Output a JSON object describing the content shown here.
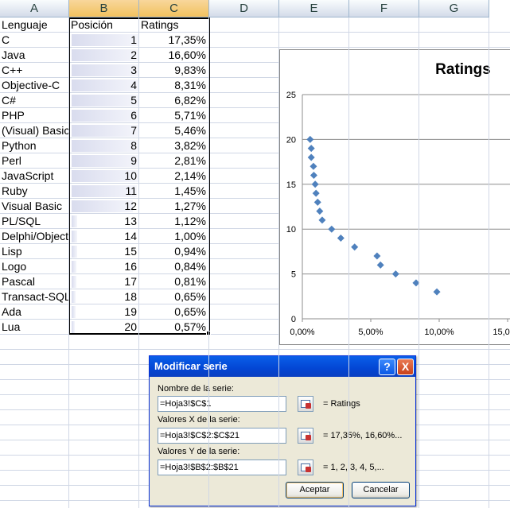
{
  "columns": [
    "A",
    "B",
    "C",
    "D",
    "E",
    "F",
    "G"
  ],
  "header_row": {
    "a": "Lenguaje",
    "b": "Posición",
    "c": "Ratings"
  },
  "rows": [
    {
      "lang": "C",
      "pos": "1",
      "rating": "17,35%",
      "bar": 1.0
    },
    {
      "lang": "Java",
      "pos": "2",
      "rating": "16,60%",
      "bar": 1.0
    },
    {
      "lang": "C++",
      "pos": "3",
      "rating": "9,83%",
      "bar": 1.0
    },
    {
      "lang": "Objective-C",
      "pos": "4",
      "rating": "8,31%",
      "bar": 1.0
    },
    {
      "lang": "C#",
      "pos": "5",
      "rating": "6,82%",
      "bar": 1.0
    },
    {
      "lang": "PHP",
      "pos": "6",
      "rating": "5,71%",
      "bar": 1.0
    },
    {
      "lang": "(Visual) Basic",
      "pos": "7",
      "rating": "5,46%",
      "bar": 1.0
    },
    {
      "lang": "Python",
      "pos": "8",
      "rating": "3,82%",
      "bar": 1.0
    },
    {
      "lang": "Perl",
      "pos": "9",
      "rating": "2,81%",
      "bar": 1.0
    },
    {
      "lang": "JavaScript",
      "pos": "10",
      "rating": "2,14%",
      "bar": 1.0
    },
    {
      "lang": "Ruby",
      "pos": "11",
      "rating": "1,45%",
      "bar": 0.98
    },
    {
      "lang": "Visual Basic",
      "pos": "12",
      "rating": "1,27%",
      "bar": 0.92
    },
    {
      "lang": "PL/SQL",
      "pos": "13",
      "rating": "1,12%",
      "bar": 0.08
    },
    {
      "lang": "Delphi/Object",
      "pos": "14",
      "rating": "1,00%",
      "bar": 0.08
    },
    {
      "lang": "Lisp",
      "pos": "15",
      "rating": "0,94%",
      "bar": 0.08
    },
    {
      "lang": "Logo",
      "pos": "16",
      "rating": "0,84%",
      "bar": 0.07
    },
    {
      "lang": "Pascal",
      "pos": "17",
      "rating": "0,81%",
      "bar": 0.07
    },
    {
      "lang": "Transact-SQL",
      "pos": "18",
      "rating": "0,65%",
      "bar": 0.06
    },
    {
      "lang": "Ada",
      "pos": "19",
      "rating": "0,65%",
      "bar": 0.06
    },
    {
      "lang": "Lua",
      "pos": "20",
      "rating": "0,57%",
      "bar": 0.05
    }
  ],
  "chart_data": {
    "type": "scatter",
    "title": "Ratings",
    "x": [
      17.35,
      16.6,
      9.83,
      8.31,
      6.82,
      5.71,
      5.46,
      3.82,
      2.81,
      2.14,
      1.45,
      1.27,
      1.12,
      1.0,
      0.94,
      0.84,
      0.81,
      0.65,
      0.65,
      0.57
    ],
    "y": [
      1,
      2,
      3,
      4,
      5,
      6,
      7,
      8,
      9,
      10,
      11,
      12,
      13,
      14,
      15,
      16,
      17,
      18,
      19,
      20
    ],
    "x_tick_labels": [
      "0,00%",
      "5,00%",
      "10,00%",
      "15,00%"
    ],
    "x_ticks": [
      0,
      5,
      10,
      15
    ],
    "y_tick_labels": [
      "0",
      "5",
      "10",
      "15",
      "20",
      "25"
    ],
    "y_ticks": [
      0,
      5,
      10,
      15,
      20,
      25
    ],
    "xlim": [
      0,
      15
    ],
    "ylim": [
      0,
      25
    ],
    "grid": "horizontal",
    "marker_color": "#4f81bd"
  },
  "dialog": {
    "title": "Modificar serie",
    "help_label": "?",
    "close_label": "X",
    "name_label": "Nombre de la serie:",
    "name_value": "=Hoja3!$C$1",
    "name_result": "= Ratings",
    "x_label": "Valores X de la serie:",
    "x_value": "=Hoja3!$C$2:$C$21",
    "x_result": "= 17,35%, 16,60%...",
    "y_label": "Valores Y de la serie:",
    "y_value": "=Hoja3!$B$2:$B$21",
    "y_result": "= 1, 2, 3, 4, 5,...",
    "ok_label": "Aceptar",
    "cancel_label": "Cancelar"
  }
}
